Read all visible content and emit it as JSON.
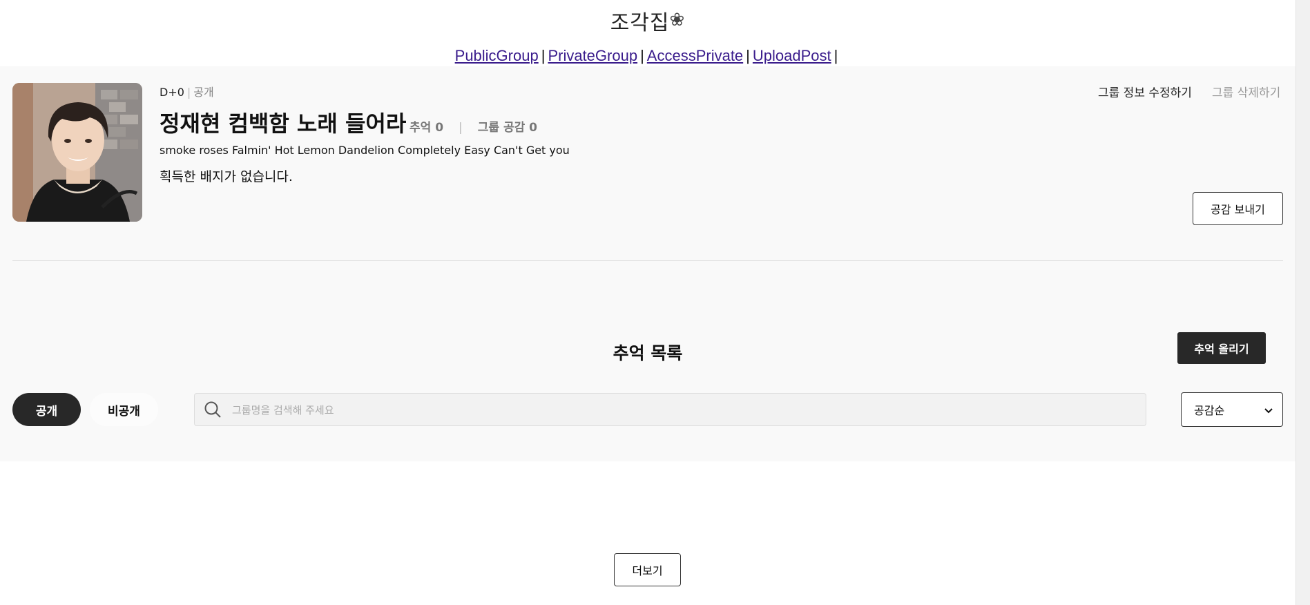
{
  "header": {
    "logo_text": "조각집",
    "logo_flower": "❀"
  },
  "nav": {
    "links": [
      "PublicGroup",
      "PrivateGroup",
      "AccessPrivate",
      "UploadPost"
    ],
    "separator": "|"
  },
  "group": {
    "dday": "D+0",
    "visibility": "공개",
    "name": "정재현 컴백함 노래 들어라",
    "memories_label": "추억 0",
    "likes_label": "그룹 공감 0",
    "intro": "smoke roses Falmin' Hot Lemon Dandelion Completely Easy Can't Get you",
    "badges_text": "획득한 배지가 없습니다.",
    "edit_label": "그룹 정보 수정하기",
    "delete_label": "그룹 삭제하기",
    "like_button_label": "공감 보내기"
  },
  "memories": {
    "title": "추억 목록",
    "upload_label": "추억 올리기",
    "tabs": [
      {
        "label": "공개",
        "active": true
      },
      {
        "label": "비공개",
        "active": false
      }
    ],
    "search_placeholder": "그룹명을 검색해 주세요",
    "sort_value": "공감순",
    "more_label": "더보기"
  },
  "icons": {
    "search": "search-icon",
    "dropdown": "chevron-down-icon",
    "logo_decoration": "flower-icon"
  },
  "colors": {
    "link": "#3a1c8c",
    "dark_button": "#282828",
    "panel_bg": "#f9f9f9"
  }
}
